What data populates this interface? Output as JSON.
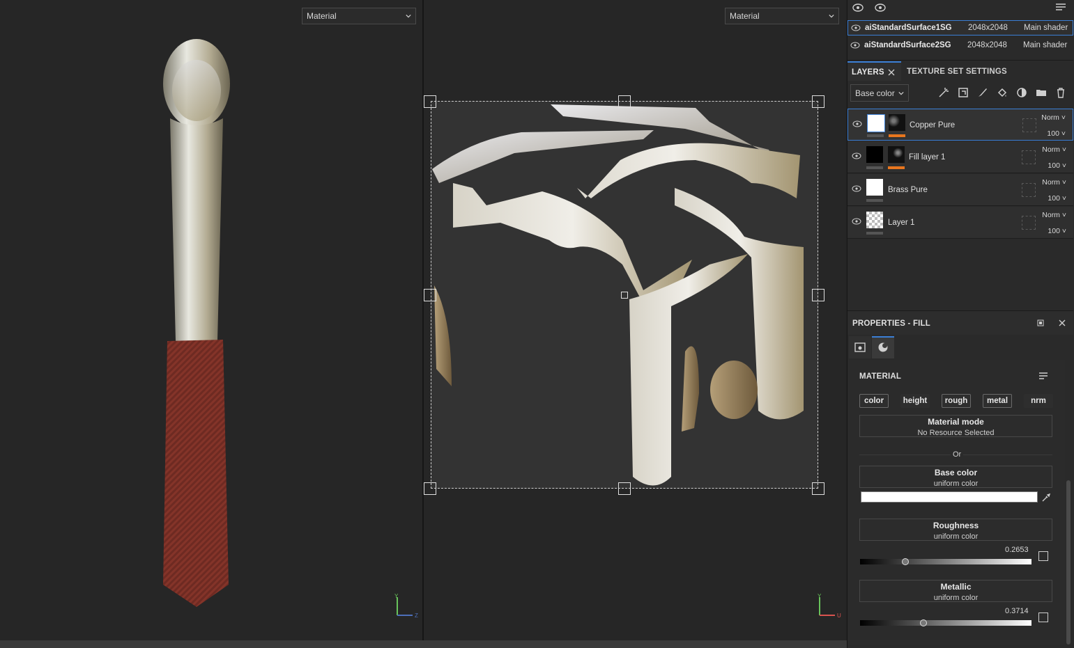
{
  "viewport3d": {
    "mode": "Material",
    "axis_y": "Y",
    "axis_z": "Z"
  },
  "viewport2d": {
    "mode": "Material",
    "axis_y": "Y",
    "axis_u": "U"
  },
  "texture_sets": [
    {
      "name": "aiStandardSurface1SG",
      "resolution": "2048x2048",
      "shader": "Main shader",
      "selected": true
    },
    {
      "name": "aiStandardSurface2SG",
      "resolution": "2048x2048",
      "shader": "Main shader",
      "selected": false
    }
  ],
  "tabs": {
    "layers": "LAYERS",
    "texture_set_settings": "TEXTURE SET SETTINGS"
  },
  "channel_dropdown": "Base color",
  "layers": [
    {
      "name": "Copper Pure",
      "blend": "Norm",
      "opacity": "100",
      "selected": true
    },
    {
      "name": "Fill layer 1",
      "blend": "Norm",
      "opacity": "100",
      "selected": false
    },
    {
      "name": "Brass Pure",
      "blend": "Norm",
      "opacity": "100",
      "selected": false
    },
    {
      "name": "Layer 1",
      "blend": "Norm",
      "opacity": "100",
      "selected": false
    }
  ],
  "properties": {
    "title": "PROPERTIES - FILL",
    "section": "MATERIAL",
    "channels": [
      "color",
      "height",
      "rough",
      "metal",
      "nrm"
    ],
    "material_mode": {
      "title": "Material mode",
      "value": "No Resource Selected"
    },
    "or_label": "Or",
    "base_color": {
      "title": "Base color",
      "sub": "uniform color",
      "color": "#ffffff"
    },
    "roughness": {
      "title": "Roughness",
      "sub": "uniform color",
      "value": "0.2653",
      "fraction": 0.2653
    },
    "metallic": {
      "title": "Metallic",
      "sub": "uniform color",
      "value": "0.3714",
      "fraction": 0.3714
    }
  },
  "colors": {
    "accent": "#3b7fd6",
    "mask_orange": "#e8761e",
    "handle_red": "#7a2a22"
  }
}
